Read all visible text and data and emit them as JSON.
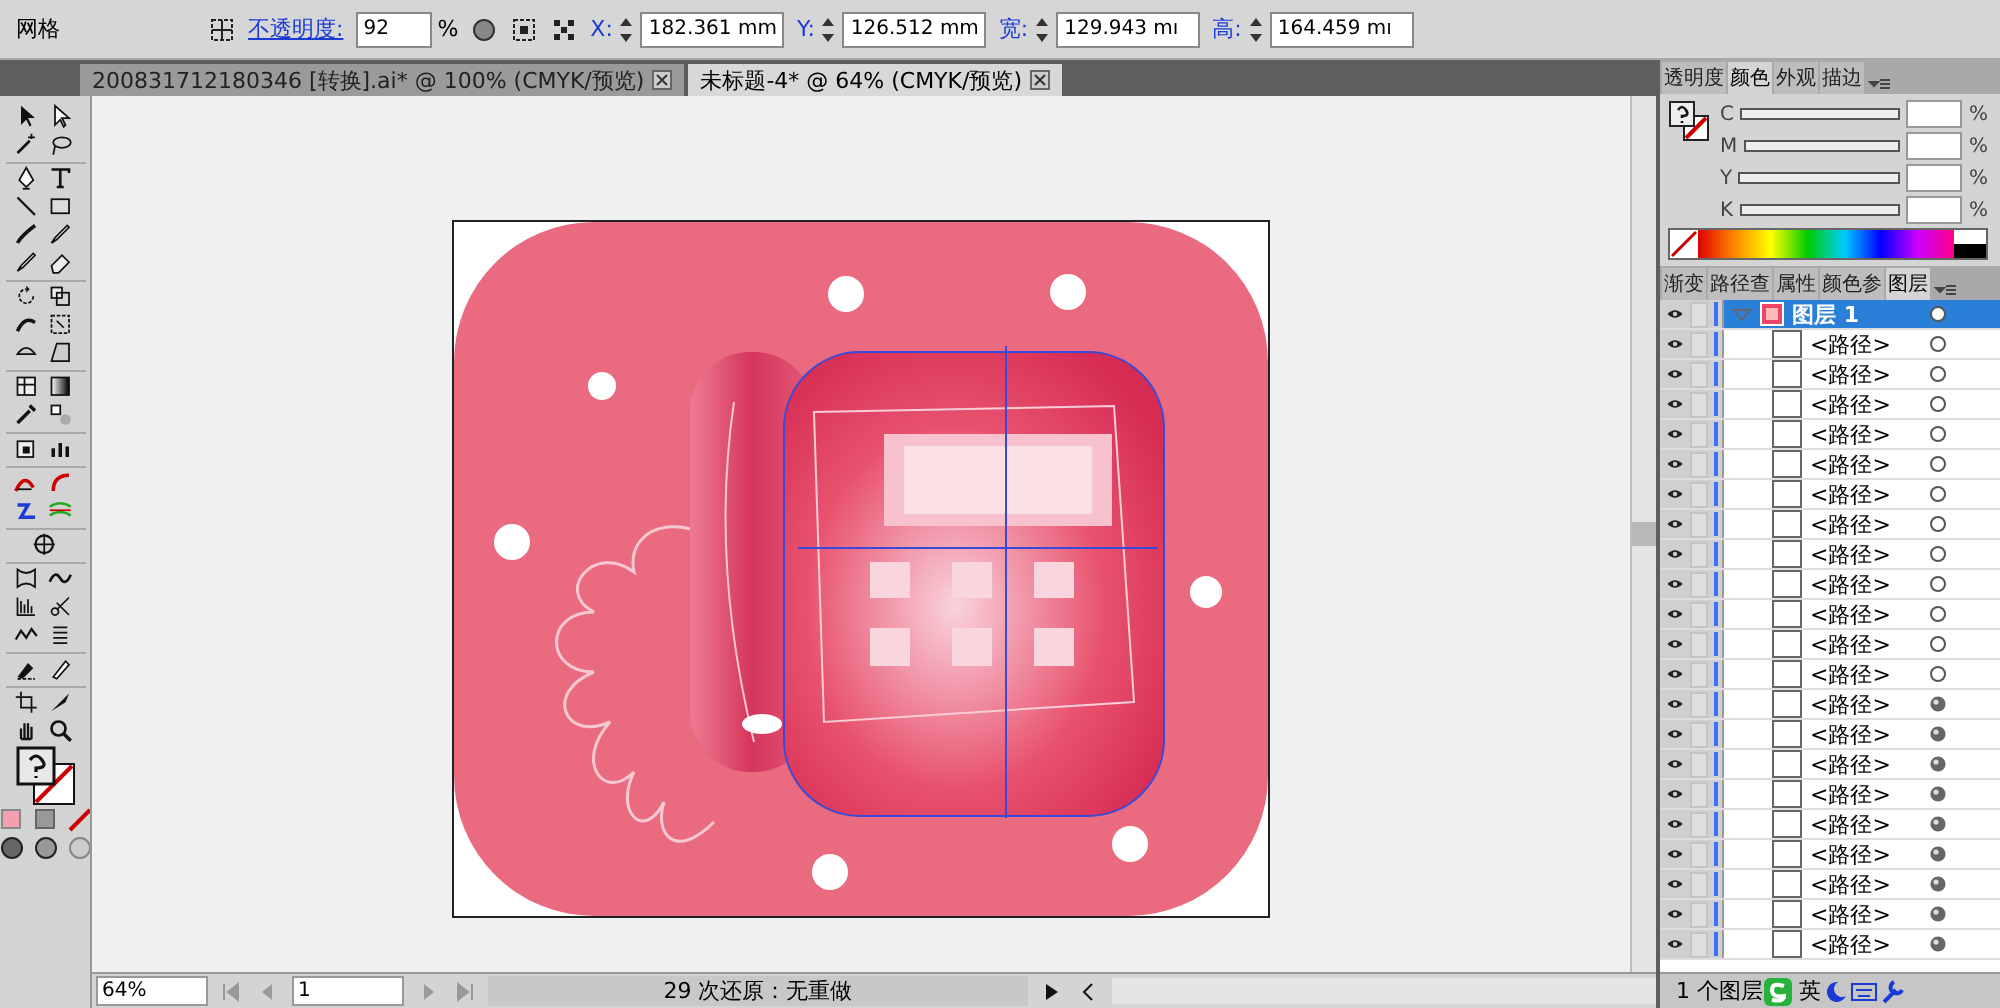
{
  "control_bar": {
    "tool_name": "网格",
    "opacity_label": "不透明度:",
    "opacity": "92",
    "percent": "%",
    "fields": [
      {
        "label": "X:",
        "value": "182.361 mm"
      },
      {
        "label": "Y:",
        "value": "126.512 mm"
      },
      {
        "label": "宽:",
        "value": "129.943 mı"
      },
      {
        "label": "高:",
        "value": "164.459 mı"
      }
    ]
  },
  "document_tabs": [
    {
      "label": "200831712180346  [转换].ai* @ 100% (CMYK/预览)",
      "selected": false
    },
    {
      "label": "未标题-4* @ 64% (CMYK/预览)",
      "selected": true
    }
  ],
  "color_panel": {
    "tabs": [
      {
        "label": "透明度",
        "selected": false
      },
      {
        "label": "颜色",
        "selected": true
      },
      {
        "label": "外观",
        "selected": false
      },
      {
        "label": "描边",
        "selected": false
      }
    ],
    "sliders": [
      {
        "label": "C",
        "unit": "%"
      },
      {
        "label": "M",
        "unit": "%"
      },
      {
        "label": "Y",
        "unit": "%"
      },
      {
        "label": "K",
        "unit": "%"
      }
    ]
  },
  "layers_panel": {
    "tabs": [
      {
        "label": "渐变",
        "selected": false
      },
      {
        "label": "路径查",
        "selected": false
      },
      {
        "label": "属性",
        "selected": false
      },
      {
        "label": "颜色参",
        "selected": false
      },
      {
        "label": "图层",
        "selected": true
      }
    ],
    "layer": {
      "name": "图层 1",
      "selected": true,
      "expanded": true,
      "children": [
        {
          "name": "<路径>",
          "appearance": false
        },
        {
          "name": "<路径>",
          "appearance": false
        },
        {
          "name": "<路径>",
          "appearance": false
        },
        {
          "name": "<路径>",
          "appearance": false
        },
        {
          "name": "<路径>",
          "appearance": false
        },
        {
          "name": "<路径>",
          "appearance": false
        },
        {
          "name": "<路径>",
          "appearance": false
        },
        {
          "name": "<路径>",
          "appearance": false
        },
        {
          "name": "<路径>",
          "appearance": false
        },
        {
          "name": "<路径>",
          "appearance": false
        },
        {
          "name": "<路径>",
          "appearance": false
        },
        {
          "name": "<路径>",
          "appearance": false
        },
        {
          "name": "<路径>",
          "appearance": true
        },
        {
          "name": "<路径>",
          "appearance": true
        },
        {
          "name": "<路径>",
          "appearance": true
        },
        {
          "name": "<路径>",
          "appearance": true
        },
        {
          "name": "<路径>",
          "appearance": true
        },
        {
          "name": "<路径>",
          "appearance": true
        },
        {
          "name": "<路径>",
          "appearance": true
        },
        {
          "name": "<路径>",
          "appearance": true
        },
        {
          "name": "<路径>",
          "appearance": true
        }
      ]
    },
    "footer": "1 个图层"
  },
  "status_bar": {
    "zoom": "64%",
    "artboard": "1",
    "history": "29 次还原：无重做"
  },
  "ime_bar": {
    "label": "英"
  }
}
